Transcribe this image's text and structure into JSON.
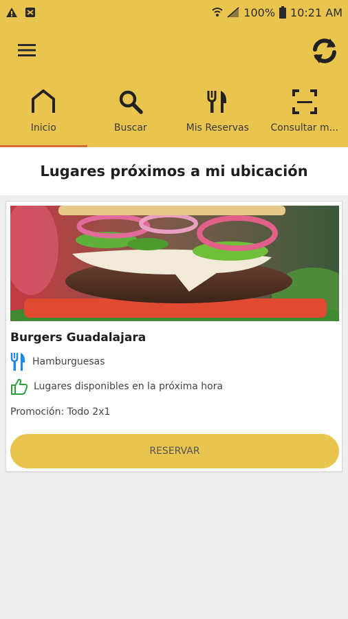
{
  "status_bar": {
    "battery_percent": "100%",
    "time": "10:21 AM",
    "icons": [
      "warning-icon",
      "image-icon",
      "wifi-icon",
      "signal-icon",
      "battery-icon"
    ]
  },
  "toolbar": {
    "menu_icon": "hamburger-menu-icon",
    "refresh_icon": "refresh-icon"
  },
  "tabs": [
    {
      "label": "Inicio",
      "icon": "home-icon",
      "active": true
    },
    {
      "label": "Buscar",
      "icon": "search-icon",
      "active": false
    },
    {
      "label": "Mis Reservas",
      "icon": "fork-knife-icon",
      "active": false
    },
    {
      "label": "Consultar m...",
      "icon": "scan-icon",
      "active": false
    }
  ],
  "section": {
    "title": "Lugares próximos a mi ubicación"
  },
  "restaurant": {
    "name": "Burgers Guadalajara",
    "category": "Hamburguesas",
    "availability": "Lugares disponibles en la próxima hora",
    "promotion": "Promoción: Todo 2x1",
    "reserve_label": "RESERVAR"
  },
  "colors": {
    "accent": "#e9c54f",
    "tab_indicator": "#d86a35",
    "category_icon": "#1e88e5",
    "availability_icon": "#2e9e3a"
  }
}
